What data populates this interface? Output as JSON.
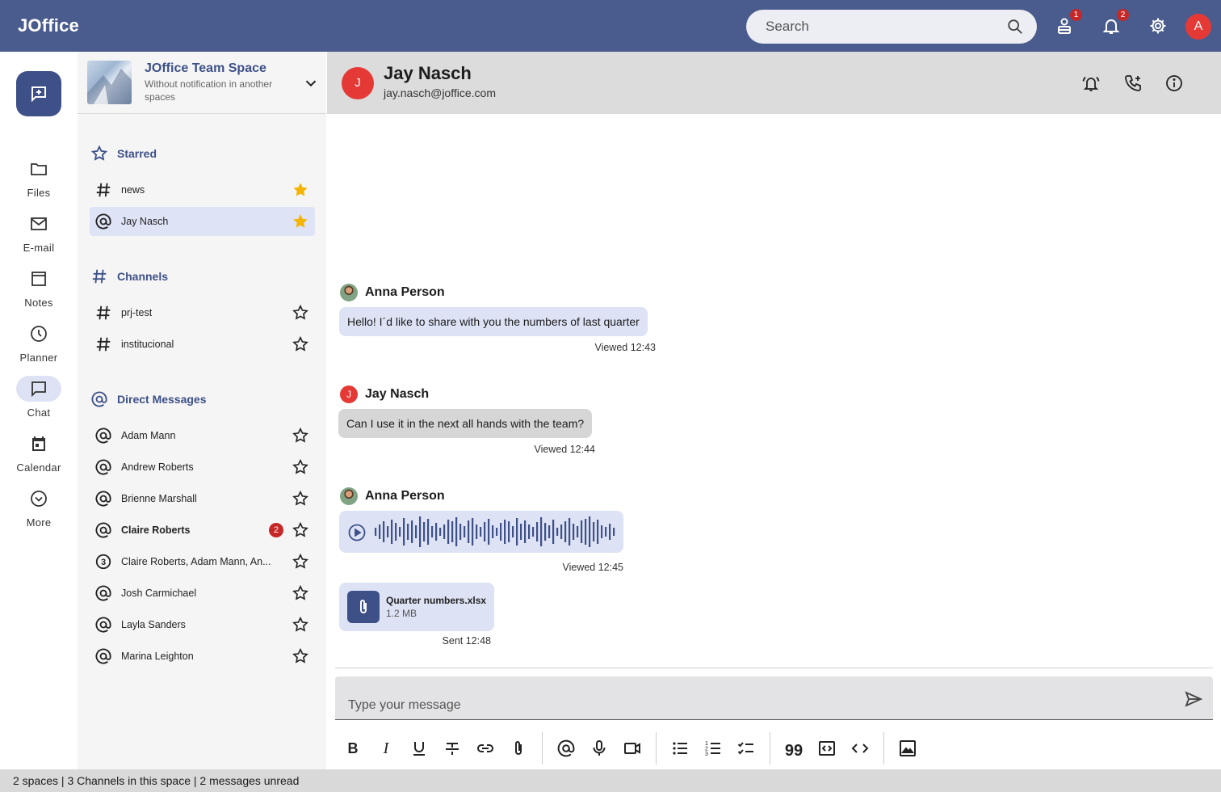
{
  "app": {
    "logo": "JOffice"
  },
  "topbar": {
    "search_placeholder": "Search",
    "contacts_badge": "1",
    "notifications_badge": "2",
    "avatar_letter": "A"
  },
  "rail": {
    "items": [
      {
        "label": "Files",
        "icon": "folder-icon"
      },
      {
        "label": "E-mail",
        "icon": "mail-icon"
      },
      {
        "label": "Notes",
        "icon": "notes-icon"
      },
      {
        "label": "Planner",
        "icon": "clock-icon"
      },
      {
        "label": "Chat",
        "icon": "chat-icon",
        "active": true
      },
      {
        "label": "Calendar",
        "icon": "calendar-icon"
      },
      {
        "label": "More",
        "icon": "chevron-circle-icon"
      }
    ]
  },
  "space": {
    "title": "JOffice Team Space",
    "subtitle": "Without notification in another spaces"
  },
  "sidebar": {
    "starred": {
      "label": "Starred",
      "items": [
        {
          "label": "news",
          "type": "channel",
          "starred": true
        },
        {
          "label": "Jay Nasch",
          "type": "dm",
          "starred": true,
          "active": true
        }
      ]
    },
    "channels": {
      "label": "Channels",
      "items": [
        {
          "label": "prj-test",
          "type": "channel"
        },
        {
          "label": "institucional",
          "type": "channel"
        }
      ]
    },
    "direct_messages": {
      "label": "Direct Messages",
      "items": [
        {
          "label": "Adam Mann",
          "type": "dm"
        },
        {
          "label": "Andrew Roberts",
          "type": "dm"
        },
        {
          "label": "Brienne Marshall",
          "type": "dm"
        },
        {
          "label": "Claire Roberts",
          "type": "dm",
          "unread": "2",
          "bold": true
        },
        {
          "label": "Claire Roberts, Adam Mann, An...",
          "type": "group",
          "group_count": "3"
        },
        {
          "label": "Josh Carmichael",
          "type": "dm"
        },
        {
          "label": "Layla Sanders",
          "type": "dm"
        },
        {
          "label": "Marina Leighton",
          "type": "dm"
        }
      ]
    }
  },
  "chat_header": {
    "avatar_letter": "J",
    "name": "Jay Nasch",
    "email": "jay.nasch@joffice.com"
  },
  "messages": [
    {
      "author": "Anna Person",
      "text": "Hello! I´d like to share with you the numbers of last quarter",
      "meta": "Viewed 12:43"
    },
    {
      "author": "Jay Nasch",
      "avatar_letter": "J",
      "text": "Can I use it in the next all hands with the team?",
      "meta": "Viewed 12:44"
    },
    {
      "author": "Anna Person",
      "type": "voice",
      "meta": "Viewed 12:45"
    },
    {
      "type": "file",
      "file_name": "Quarter numbers.xlsx",
      "file_size": "1.2 MB",
      "meta": "Sent 12:48"
    }
  ],
  "composer": {
    "placeholder": "Type your message"
  },
  "status_bar": {
    "text": "2 spaces | 3 Channels in this space | 2 messages unread"
  },
  "colors": {
    "topbar": "#4a5c8e",
    "brand": "#3d5088",
    "active_bg": "#dde2f5",
    "star_filled": "#f4b400",
    "badge": "#c62828",
    "avatar": "#e53935"
  }
}
